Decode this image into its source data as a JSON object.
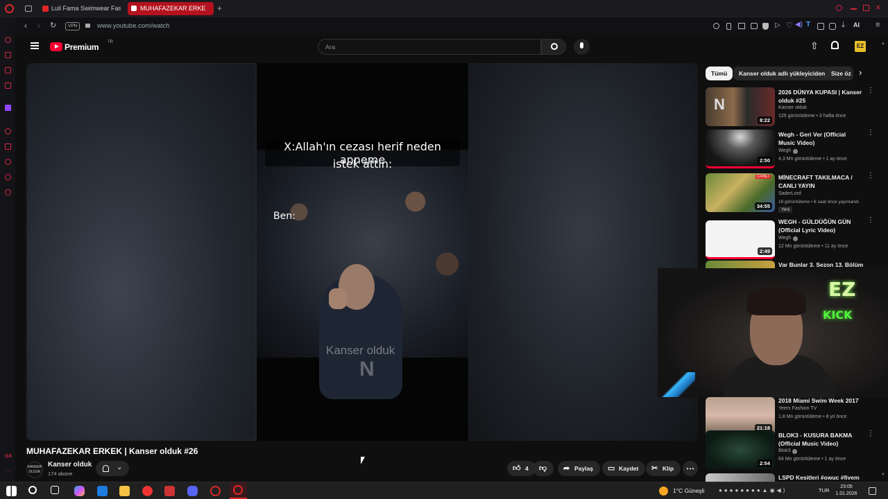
{
  "browser": {
    "tabs": [
      {
        "label": "Luli Fama Swimwear Fash",
        "active": false
      },
      {
        "label": "MUHAFAZEKAR ERKE",
        "active": true
      }
    ],
    "url": "www.youtube.com/watch",
    "vpn_label": "VPN",
    "ai_label": "AI"
  },
  "youtube": {
    "logo_text": "Premium",
    "logo_region": "TR",
    "search_placeholder": "Ara",
    "video": {
      "caption_line1": "X:Allah'ın cezası herif neden anneme",
      "caption_line2": "istek attın:",
      "caption_ben": "Ben:",
      "watermark": "Kanser olduk",
      "title": "MUHAFAZEKAR ERKEK | Kanser olduk #26",
      "channel_name": "Kanser olduk",
      "channel_avatar_text": "KANSER OLDUK",
      "subscribers": "174 abone",
      "like_count": "4",
      "share_label": "Paylaş",
      "save_label": "Kaydet",
      "clip_label": "Klip"
    },
    "chips": [
      "Tümü",
      "Kanser olduk adlı yükleyiciden",
      "Size öz"
    ],
    "recommendations": [
      {
        "title": "2026 DÜNYA KUPASI | Kanser olduk #25",
        "channel": "Kanser olduk",
        "meta": "125 görüntüleme • 3 hafta önce",
        "duration": "8:22"
      },
      {
        "title": "Wegh - Geri Ver (Official Music Video)",
        "channel": "Wegh",
        "meta": "4,3 Mn görüntüleme • 1 ay önce",
        "duration": "2:50"
      },
      {
        "title": "MİNECRAFT TAKILMACA / CANLI YAYIN",
        "channel": "SaderLord",
        "meta": "18 görüntüleme • 6 saat önce yayınlandı",
        "duration": "34:55",
        "badge": "Yeni"
      },
      {
        "title": "WEGH - GÜLDÜĞÜN GÜN (Official Lyric Video)",
        "channel": "Wegh",
        "meta": "12 Mn görüntüleme • 11 ay önce",
        "duration": "2:49"
      },
      {
        "title": "Var Bunlar 3. Sezon 13. Bölüm",
        "channel": "",
        "meta": "",
        "duration": ""
      },
      {
        "title": "2018 Miami Swim Week 2017",
        "channel": "Yeers Fashion TV",
        "meta": "1,8 Mn görüntüleme • 8 yıl önce",
        "duration": "21:18"
      },
      {
        "title": "BLOK3 - KUSURA BAKMA (Official Music Video)",
        "channel": "Blok3",
        "meta": "64 Mn görüntüleme • 1 ay önce",
        "duration": "2:54"
      },
      {
        "title": "LSPD Kesitleri #owuc #fivem",
        "channel": "",
        "meta": "",
        "duration": ""
      }
    ]
  },
  "webcam": {
    "ez_text": "EZ",
    "kick_text": "KICK"
  },
  "taskbar": {
    "weather": "1°C  Güneşli",
    "language": "TUR",
    "time": "23:05",
    "date": "1.01.2026"
  },
  "colors": {
    "youtube_red": "#ff0033",
    "opera_red": "#e02727",
    "background": "#0f0f0f"
  }
}
